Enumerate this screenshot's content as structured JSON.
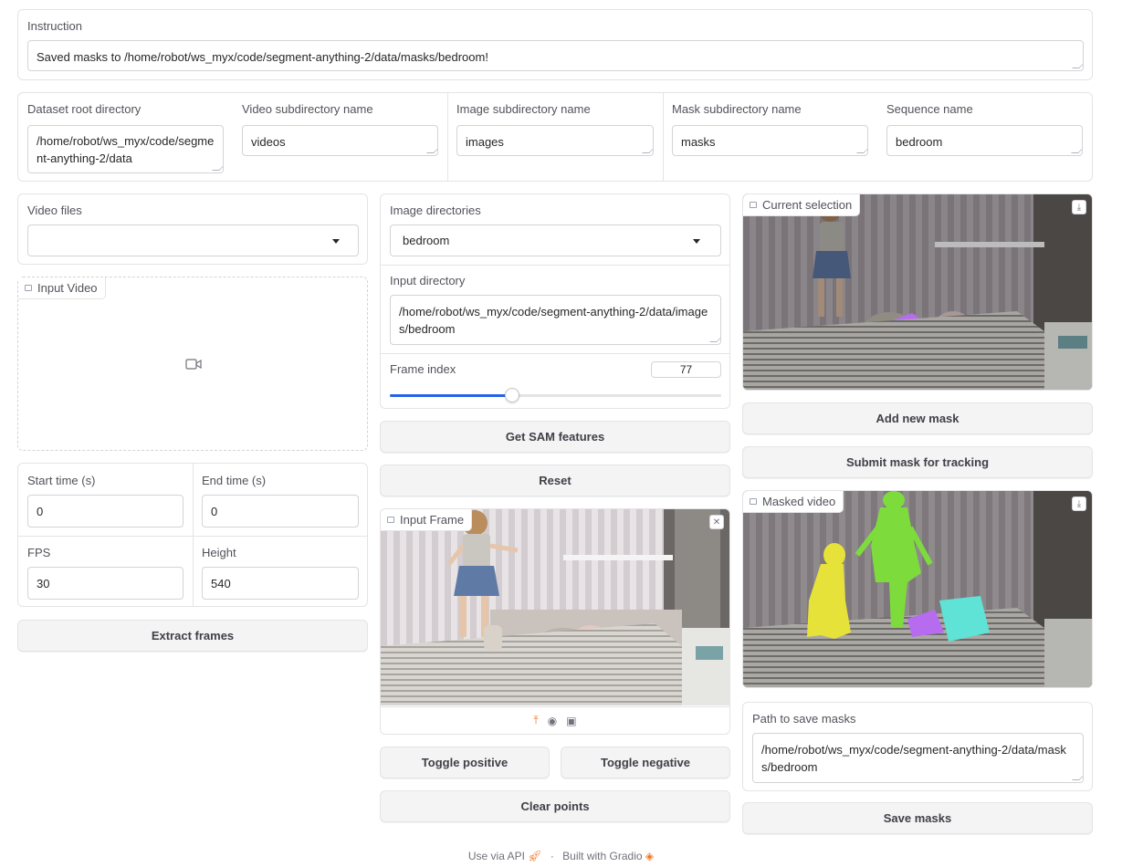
{
  "instruction": {
    "label": "Instruction",
    "value": "Saved masks to /home/robot/ws_myx/code/segment-anything-2/data/masks/bedroom!"
  },
  "dirs": {
    "dataset_root": {
      "label": "Dataset root directory",
      "value": "/home/robot/ws_myx/code/segment-anything-2/data"
    },
    "video_sub": {
      "label": "Video subdirectory name",
      "value": "videos"
    },
    "image_sub": {
      "label": "Image subdirectory name",
      "value": "images"
    },
    "mask_sub": {
      "label": "Mask subdirectory name",
      "value": "masks"
    },
    "sequence": {
      "label": "Sequence name",
      "value": "bedroom"
    }
  },
  "left": {
    "video_files": {
      "label": "Video files",
      "value": ""
    },
    "input_video_label": "Input Video",
    "start_time": {
      "label": "Start time (s)",
      "value": "0"
    },
    "end_time": {
      "label": "End time (s)",
      "value": "0"
    },
    "fps": {
      "label": "FPS",
      "value": "30"
    },
    "height": {
      "label": "Height",
      "value": "540"
    },
    "extract_button": "Extract frames"
  },
  "middle": {
    "image_dirs": {
      "label": "Image directories",
      "value": "bedroom"
    },
    "input_dir": {
      "label": "Input directory",
      "value": "/home/robot/ws_myx/code/segment-anything-2/data/images/bedroom"
    },
    "frame_index": {
      "label": "Frame index",
      "value": "77",
      "slider_fraction": 0.37
    },
    "get_sam_button": "Get SAM features",
    "reset_button": "Reset",
    "input_frame_label": "Input Frame",
    "toggle_positive_button": "Toggle positive",
    "toggle_negative_button": "Toggle negative",
    "clear_points_button": "Clear points"
  },
  "right": {
    "current_selection_label": "Current selection",
    "add_mask_button": "Add new mask",
    "submit_button": "Submit mask for tracking",
    "masked_video_label": "Masked video",
    "save_path": {
      "label": "Path to save masks",
      "value": "/home/robot/ws_myx/code/segment-anything-2/data/masks/bedroom"
    },
    "save_button": "Save masks"
  },
  "footer": {
    "api": "Use via API",
    "sep": "·",
    "built": "Built with Gradio"
  },
  "colors": {
    "slider_fill": "#2563eb",
    "mask_yellow": "#e6e23a",
    "mask_green": "#7ddc3c",
    "mask_purple": "#b76cf0",
    "mask_cyan": "#5fe3d6",
    "point_green": "#22c55e",
    "upload_orange": "#f97316"
  }
}
